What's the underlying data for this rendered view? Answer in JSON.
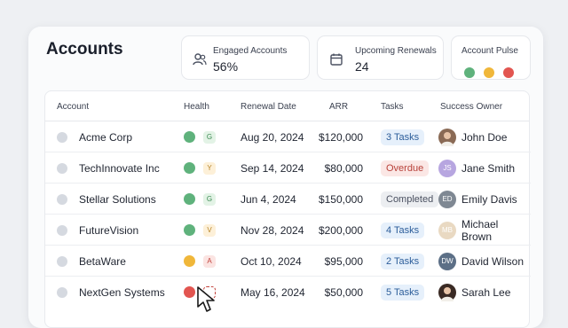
{
  "header": {
    "title": "Accounts"
  },
  "cards": {
    "engaged": {
      "label": "Engaged Accounts",
      "value": "56%",
      "icon": "users-icon"
    },
    "renewals": {
      "label": "Upcoming Renewals",
      "value": "24",
      "icon": "calendar-icon"
    },
    "pulse": {
      "label": "Account Pulse",
      "colors": [
        "#5fb27c",
        "#f0b73a",
        "#e25550"
      ]
    }
  },
  "table": {
    "columns": [
      "Account",
      "Health",
      "Renewal Date",
      "ARR",
      "Tasks",
      "Success Owner"
    ],
    "rows": [
      {
        "account": "Acme Corp",
        "health_color": "#5fb27c",
        "grade": "G",
        "renewal": "Aug 20, 2024",
        "arr": "$120,000",
        "task": "3 Tasks",
        "task_style": "blue",
        "owner": "John Doe",
        "avatar": "photo",
        "avatar_color": "#8a6a55",
        "initials": ""
      },
      {
        "account": "TechInnovate Inc",
        "health_color": "#5fb27c",
        "grade": "Y",
        "renewal": "Sep 14, 2024",
        "arr": "$80,000",
        "task": "Overdue",
        "task_style": "red",
        "owner": "Jane Smith",
        "avatar": "initials",
        "avatar_color": "#b7a6e0",
        "initials": "JS"
      },
      {
        "account": "Stellar Solutions",
        "health_color": "#5fb27c",
        "grade": "G",
        "renewal": "Jun 4, 2024",
        "arr": "$150,000",
        "task": "Completed",
        "task_style": "gray",
        "owner": "Emily Davis",
        "avatar": "initials",
        "avatar_color": "#7f8893",
        "initials": "ED"
      },
      {
        "account": "FutureVision",
        "health_color": "#5fb27c",
        "grade": "V",
        "renewal": "Nov 28, 2024",
        "arr": "$200,000",
        "task": "4 Tasks",
        "task_style": "blue",
        "owner": "Michael Brown",
        "avatar": "initials",
        "avatar_color": "#e9d9c2",
        "initials": "MB"
      },
      {
        "account": "BetaWare",
        "health_color": "#f0b73a",
        "grade": "A",
        "renewal": "Oct 10, 2024",
        "arr": "$95,000",
        "task": "2 Tasks",
        "task_style": "blue",
        "owner": "David Wilson",
        "avatar": "initials",
        "avatar_color": "#5c6f86",
        "initials": "DW"
      },
      {
        "account": "NextGen Systems",
        "health_color": "#e25550",
        "grade": "",
        "renewal": "May 16, 2024",
        "arr": "$50,000",
        "task": "5 Tasks",
        "task_style": "blue",
        "owner": "Sarah Lee",
        "avatar": "photo",
        "avatar_color": "#3a2a24",
        "initials": ""
      }
    ]
  },
  "colors": {
    "grade_G_bg": "#e3f3e6",
    "grade_G_fg": "#3c8a53",
    "grade_Y_bg": "#fdf0d8",
    "grade_Y_fg": "#b7852a",
    "grade_V_bg": "#fdf0d8",
    "grade_V_fg": "#b7852a",
    "grade_A_bg": "#fbe4e2",
    "grade_A_fg": "#c2433c",
    "task_blue_bg": "#e6f0fb",
    "task_blue_fg": "#2c5d9a",
    "task_red_bg": "#fbe7e5",
    "task_red_fg": "#b8413a",
    "task_gray_bg": "#eceef1",
    "task_gray_fg": "#4a5060"
  }
}
